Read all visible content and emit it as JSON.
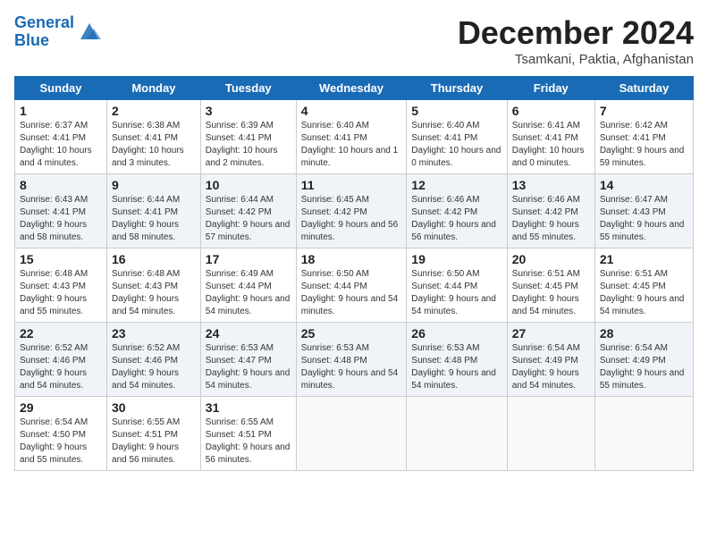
{
  "header": {
    "logo_line1": "General",
    "logo_line2": "Blue",
    "month": "December 2024",
    "location": "Tsamkani, Paktia, Afghanistan"
  },
  "days_of_week": [
    "Sunday",
    "Monday",
    "Tuesday",
    "Wednesday",
    "Thursday",
    "Friday",
    "Saturday"
  ],
  "weeks": [
    [
      {
        "day": 1,
        "info": "Sunrise: 6:37 AM\nSunset: 4:41 PM\nDaylight: 10 hours\nand 4 minutes."
      },
      {
        "day": 2,
        "info": "Sunrise: 6:38 AM\nSunset: 4:41 PM\nDaylight: 10 hours\nand 3 minutes."
      },
      {
        "day": 3,
        "info": "Sunrise: 6:39 AM\nSunset: 4:41 PM\nDaylight: 10 hours\nand 2 minutes."
      },
      {
        "day": 4,
        "info": "Sunrise: 6:40 AM\nSunset: 4:41 PM\nDaylight: 10 hours\nand 1 minute."
      },
      {
        "day": 5,
        "info": "Sunrise: 6:40 AM\nSunset: 4:41 PM\nDaylight: 10 hours\nand 0 minutes."
      },
      {
        "day": 6,
        "info": "Sunrise: 6:41 AM\nSunset: 4:41 PM\nDaylight: 10 hours\nand 0 minutes."
      },
      {
        "day": 7,
        "info": "Sunrise: 6:42 AM\nSunset: 4:41 PM\nDaylight: 9 hours\nand 59 minutes."
      }
    ],
    [
      {
        "day": 8,
        "info": "Sunrise: 6:43 AM\nSunset: 4:41 PM\nDaylight: 9 hours\nand 58 minutes."
      },
      {
        "day": 9,
        "info": "Sunrise: 6:44 AM\nSunset: 4:41 PM\nDaylight: 9 hours\nand 58 minutes."
      },
      {
        "day": 10,
        "info": "Sunrise: 6:44 AM\nSunset: 4:42 PM\nDaylight: 9 hours\nand 57 minutes."
      },
      {
        "day": 11,
        "info": "Sunrise: 6:45 AM\nSunset: 4:42 PM\nDaylight: 9 hours\nand 56 minutes."
      },
      {
        "day": 12,
        "info": "Sunrise: 6:46 AM\nSunset: 4:42 PM\nDaylight: 9 hours\nand 56 minutes."
      },
      {
        "day": 13,
        "info": "Sunrise: 6:46 AM\nSunset: 4:42 PM\nDaylight: 9 hours\nand 55 minutes."
      },
      {
        "day": 14,
        "info": "Sunrise: 6:47 AM\nSunset: 4:43 PM\nDaylight: 9 hours\nand 55 minutes."
      }
    ],
    [
      {
        "day": 15,
        "info": "Sunrise: 6:48 AM\nSunset: 4:43 PM\nDaylight: 9 hours\nand 55 minutes."
      },
      {
        "day": 16,
        "info": "Sunrise: 6:48 AM\nSunset: 4:43 PM\nDaylight: 9 hours\nand 54 minutes."
      },
      {
        "day": 17,
        "info": "Sunrise: 6:49 AM\nSunset: 4:44 PM\nDaylight: 9 hours\nand 54 minutes."
      },
      {
        "day": 18,
        "info": "Sunrise: 6:50 AM\nSunset: 4:44 PM\nDaylight: 9 hours\nand 54 minutes."
      },
      {
        "day": 19,
        "info": "Sunrise: 6:50 AM\nSunset: 4:44 PM\nDaylight: 9 hours\nand 54 minutes."
      },
      {
        "day": 20,
        "info": "Sunrise: 6:51 AM\nSunset: 4:45 PM\nDaylight: 9 hours\nand 54 minutes."
      },
      {
        "day": 21,
        "info": "Sunrise: 6:51 AM\nSunset: 4:45 PM\nDaylight: 9 hours\nand 54 minutes."
      }
    ],
    [
      {
        "day": 22,
        "info": "Sunrise: 6:52 AM\nSunset: 4:46 PM\nDaylight: 9 hours\nand 54 minutes."
      },
      {
        "day": 23,
        "info": "Sunrise: 6:52 AM\nSunset: 4:46 PM\nDaylight: 9 hours\nand 54 minutes."
      },
      {
        "day": 24,
        "info": "Sunrise: 6:53 AM\nSunset: 4:47 PM\nDaylight: 9 hours\nand 54 minutes."
      },
      {
        "day": 25,
        "info": "Sunrise: 6:53 AM\nSunset: 4:48 PM\nDaylight: 9 hours\nand 54 minutes."
      },
      {
        "day": 26,
        "info": "Sunrise: 6:53 AM\nSunset: 4:48 PM\nDaylight: 9 hours\nand 54 minutes."
      },
      {
        "day": 27,
        "info": "Sunrise: 6:54 AM\nSunset: 4:49 PM\nDaylight: 9 hours\nand 54 minutes."
      },
      {
        "day": 28,
        "info": "Sunrise: 6:54 AM\nSunset: 4:49 PM\nDaylight: 9 hours\nand 55 minutes."
      }
    ],
    [
      {
        "day": 29,
        "info": "Sunrise: 6:54 AM\nSunset: 4:50 PM\nDaylight: 9 hours\nand 55 minutes."
      },
      {
        "day": 30,
        "info": "Sunrise: 6:55 AM\nSunset: 4:51 PM\nDaylight: 9 hours\nand 56 minutes."
      },
      {
        "day": 31,
        "info": "Sunrise: 6:55 AM\nSunset: 4:51 PM\nDaylight: 9 hours\nand 56 minutes."
      },
      {
        "day": null
      },
      {
        "day": null
      },
      {
        "day": null
      },
      {
        "day": null
      }
    ]
  ]
}
